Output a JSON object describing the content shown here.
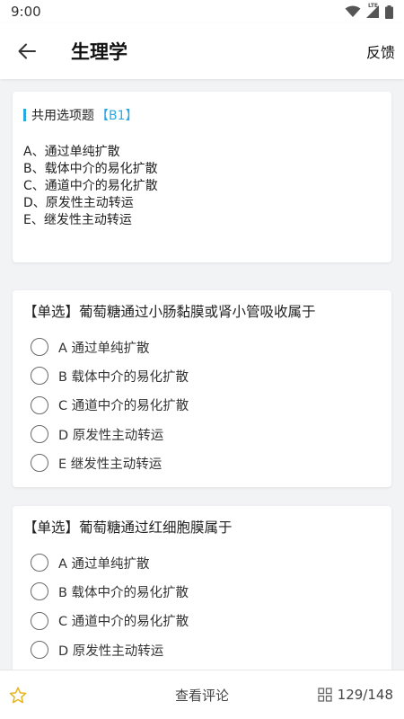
{
  "status": {
    "time": "9:00",
    "network": "LTE"
  },
  "header": {
    "title": "生理学",
    "feedback_label": "反馈"
  },
  "shared_card": {
    "label": "共用选项题",
    "tag": "【B1】",
    "options": [
      "A、通过单纯扩散",
      "B、载体中介的易化扩散",
      "C、通道中介的易化扩散",
      "D、原发性主动转运",
      "E、继发性主动转运"
    ]
  },
  "questions": [
    {
      "stem": "【单选】葡萄糖通过小肠黏膜或肾小管吸收属于",
      "options": [
        "A 通过单纯扩散",
        "B 载体中介的易化扩散",
        "C 通道中介的易化扩散",
        "D 原发性主动转运",
        "E 继发性主动转运"
      ]
    },
    {
      "stem": "【单选】葡萄糖通过红细胞膜属于",
      "options": [
        "A 通过单纯扩散",
        "B 载体中介的易化扩散",
        "C 通道中介的易化扩散",
        "D 原发性主动转运"
      ]
    }
  ],
  "footer": {
    "comment_label": "查看评论",
    "progress": "129/148"
  },
  "colors": {
    "accent": "#2aa8e0",
    "star": "#e8b31c"
  }
}
